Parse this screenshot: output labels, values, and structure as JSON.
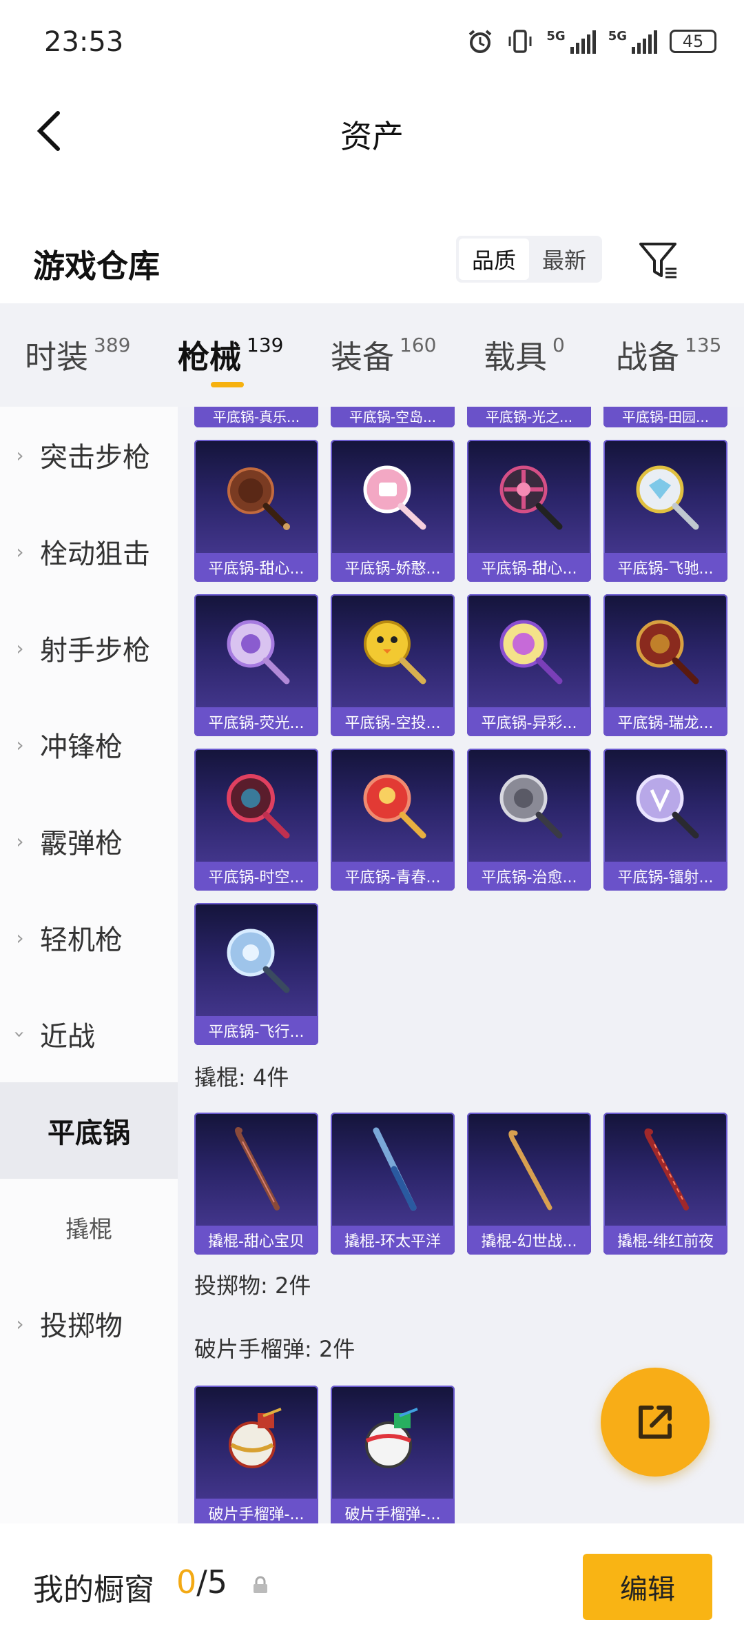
{
  "status": {
    "time": "23:53",
    "net1": "5G",
    "net2": "5G",
    "battery": "45"
  },
  "header": {
    "title": "资产"
  },
  "section": {
    "title": "游戏仓库",
    "sort_quality": "品质",
    "sort_latest": "最新"
  },
  "tabs": [
    {
      "label": "时装",
      "count": "389"
    },
    {
      "label": "枪械",
      "count": "139"
    },
    {
      "label": "装备",
      "count": "160"
    },
    {
      "label": "载具",
      "count": "0"
    },
    {
      "label": "战备",
      "count": "135"
    }
  ],
  "sidebar": {
    "items": [
      "突击步枪",
      "栓动狙击",
      "射手步枪",
      "冲锋枪",
      "霰弹枪",
      "轻机枪",
      "近战"
    ],
    "sub_active": "平底锅",
    "sub_other": "撬棍",
    "last": "投掷物"
  },
  "content": {
    "peek_row": [
      "平底锅-真乐...",
      "平底锅-空岛...",
      "平底锅-光之...",
      "平底锅-田园..."
    ],
    "pans_row1": [
      "平底锅-甜心...",
      "平底锅-娇憨...",
      "平底锅-甜心...",
      "平底锅-飞驰..."
    ],
    "pans_row2": [
      "平底锅-荧光...",
      "平底锅-空投...",
      "平底锅-异彩...",
      "平底锅-瑞龙..."
    ],
    "pans_row3": [
      "平底锅-时空...",
      "平底锅-青春...",
      "平底锅-治愈...",
      "平底锅-镭射..."
    ],
    "pans_row4": [
      "平底锅-飞行..."
    ],
    "crowbar_label": "撬棍: 4件",
    "crowbars": [
      "撬棍-甜心宝贝",
      "撬棍-环太平洋",
      "撬棍-幻世战...",
      "撬棍-绯红前夜"
    ],
    "throw_label": "投掷物: 2件",
    "grenade_label": "破片手榴弹: 2件",
    "grenades": [
      "破片手榴弹-...",
      "破片手榴弹-..."
    ]
  },
  "bottom": {
    "window_label": "我的橱窗",
    "current": "0",
    "total": "/5",
    "edit": "编辑"
  },
  "colors": {
    "accent": "#f9b414",
    "card_name_bg": "#6a52c9",
    "content_bg": "#f0f1f6"
  }
}
